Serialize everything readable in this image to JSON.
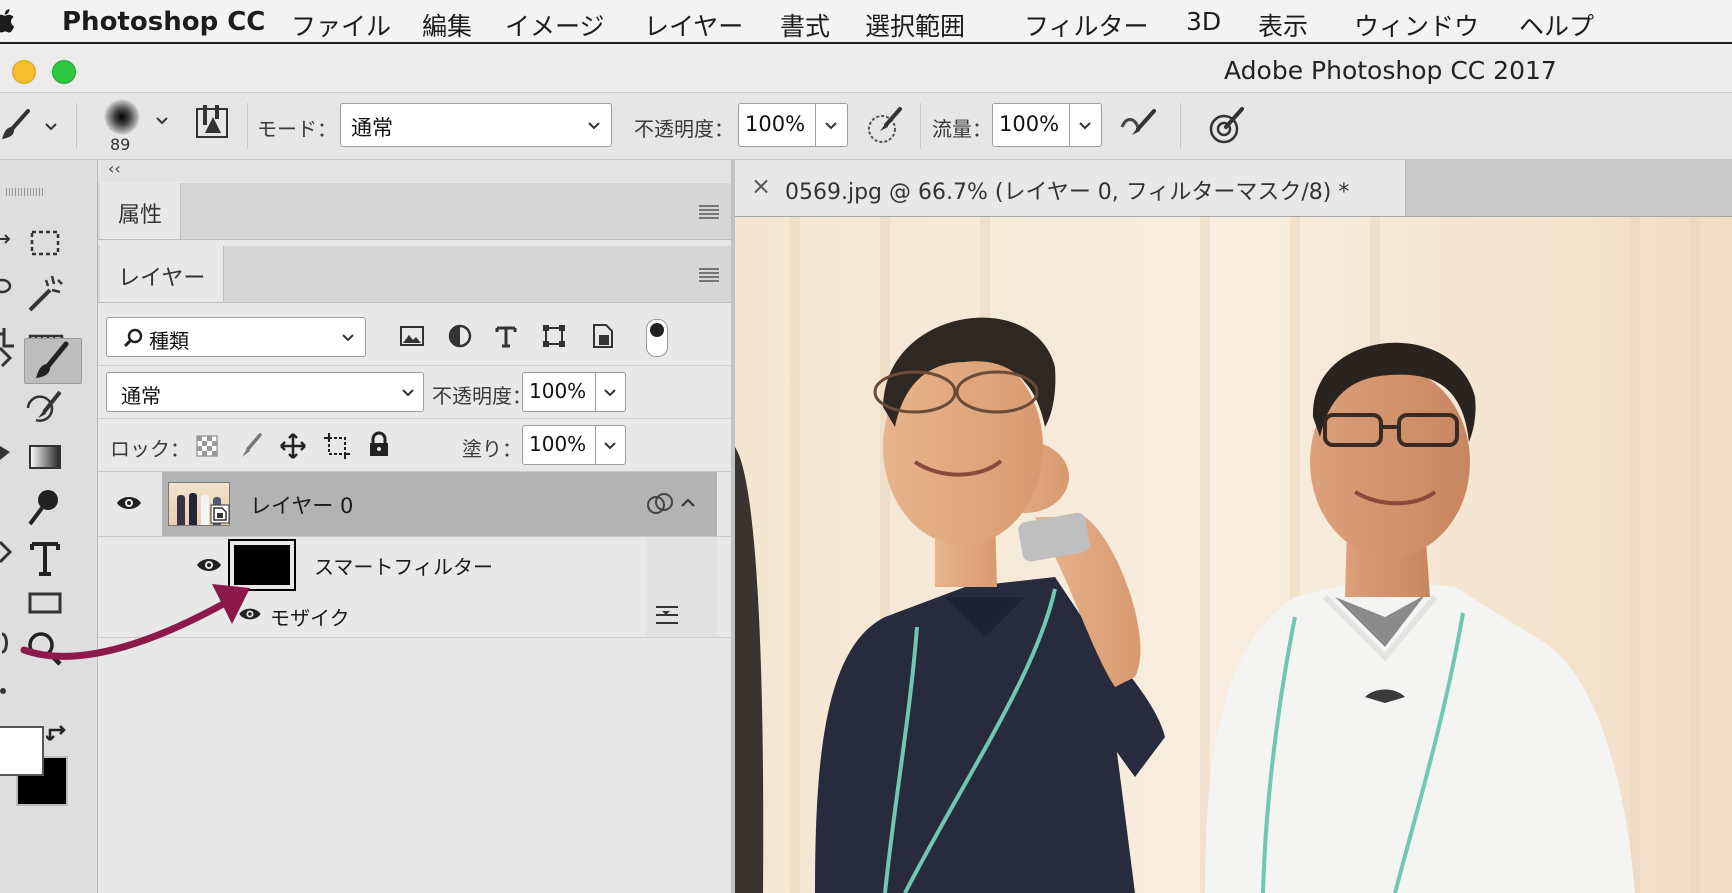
{
  "menubar": {
    "app_name": "Photoshop CC",
    "items": [
      "ファイル",
      "編集",
      "イメージ",
      "レイヤー",
      "書式",
      "選択範囲",
      "フィルター",
      "3D",
      "表示",
      "ウィンドウ",
      "ヘルプ"
    ]
  },
  "window": {
    "title": "Adobe Photoshop CC 2017"
  },
  "options": {
    "brush_size": "89",
    "mode_label": "モード：",
    "mode_value": "通常",
    "opacity_label": "不透明度：",
    "opacity_value": "100%",
    "flow_label": "流量：",
    "flow_value": "100%"
  },
  "panels": {
    "collapse_glyph": "‹‹",
    "properties_tab": "属性",
    "layers_tab": "レイヤー",
    "filter_kind": "種類",
    "blend_mode": "通常",
    "opacity_label": "不透明度：",
    "opacity_value": "100%",
    "lock_label": "ロック：",
    "fill_label": "塗り：",
    "fill_value": "100%",
    "layers": [
      {
        "name": "レイヤー 0"
      },
      {
        "name": "スマートフィルター"
      },
      {
        "name": "モザイク"
      }
    ]
  },
  "document": {
    "close_glyph": "×",
    "tab_title": "0569.jpg @ 66.7% (レイヤー 0, フィルターマスク/8) *"
  },
  "colors": {
    "accent_arrow": "#8b1a4a",
    "traffic_yellow": "#f5bf2e",
    "traffic_green": "#2ec840",
    "selected_layer": "#b3b3b3"
  }
}
